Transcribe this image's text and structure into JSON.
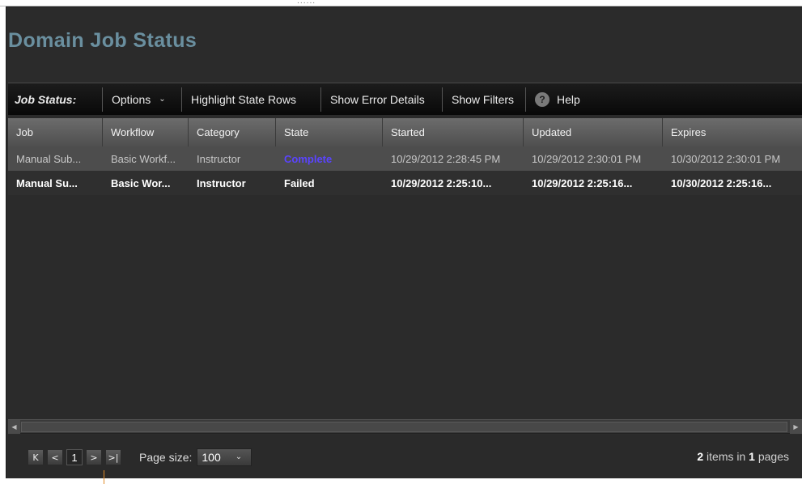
{
  "page": {
    "title": "Domain Job Status"
  },
  "top_grip": "......",
  "toolbar": {
    "label": "Job Status:",
    "options": "Options",
    "highlight": "Highlight State Rows",
    "errors": "Show Error Details",
    "filters": "Show Filters",
    "help": "Help",
    "help_icon": "?"
  },
  "grid": {
    "columns": [
      "Job",
      "Workflow",
      "Category",
      "State",
      "Started",
      "Updated",
      "Expires"
    ],
    "rows": [
      [
        "Manual Sub...",
        "Basic Workf...",
        "Instructor",
        "Complete",
        "10/29/2012 2:28:45 PM",
        "10/29/2012 2:30:01 PM",
        "10/30/2012 2:30:01 PM"
      ],
      [
        "Manual Su...",
        "Basic Wor...",
        "Instructor",
        "Failed",
        "10/29/2012 2:25:10...",
        "10/29/2012 2:25:16...",
        "10/30/2012 2:25:16..."
      ]
    ]
  },
  "scrollbar": {
    "left": "◀",
    "right": "▶"
  },
  "pager": {
    "first": "K",
    "prev": "<",
    "page": "1",
    "next": ">",
    "last": ">|",
    "size_label": "Page size:",
    "size_value": "100",
    "items_count": "2",
    "items_mid": "items in",
    "pages_count": "1",
    "pages_word": "pages"
  },
  "colors": {
    "title": "#6a8f9f",
    "state_complete": "#5a44ff"
  }
}
